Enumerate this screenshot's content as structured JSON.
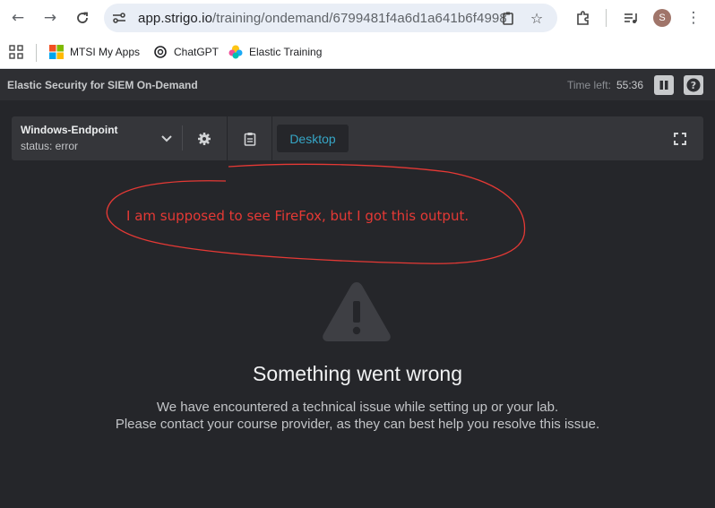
{
  "browser": {
    "url_host": "app.strigo.io",
    "url_path": "/training/ondemand/6799481f4a6d1a641b6f4998",
    "avatar_letter": "S",
    "icons": [
      "back-icon",
      "forward-icon",
      "reload-icon",
      "site-info-icon",
      "clipboard-icon",
      "star-icon",
      "extensions-icon",
      "media-icon",
      "menu-icon"
    ]
  },
  "bookmarks": [
    {
      "label": "MTSI My Apps",
      "icon": "microsoft-icon"
    },
    {
      "label": "ChatGPT",
      "icon": "chatgpt-icon"
    },
    {
      "label": "Elastic Training",
      "icon": "elastic-icon"
    }
  ],
  "header": {
    "title": "Elastic Security for SIEM On-Demand",
    "time_label": "Time left:",
    "time_value": "55:36"
  },
  "toolbar": {
    "vm_name": "Windows-Endpoint",
    "vm_status": "status: error",
    "desktop_tab": "Desktop"
  },
  "annotation": {
    "text": "I am supposed to see FireFox, but I got this output.",
    "color": "#e53935"
  },
  "error": {
    "title": "Something went wrong",
    "line1": "We have encountered a technical issue while setting up or your lab.",
    "line2": "Please contact your course provider, as they can best help you resolve this issue."
  },
  "colors": {
    "accent": "#36a6c6",
    "background": "#25262a",
    "toolbar": "#35363a"
  }
}
